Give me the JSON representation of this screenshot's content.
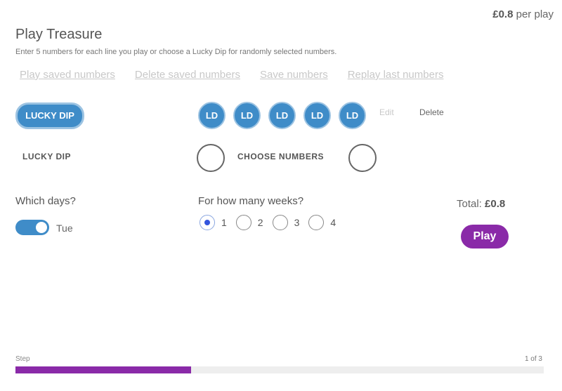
{
  "header": {
    "price_value": "£0.8",
    "price_suffix": "per play",
    "title": "Play Treasure",
    "subtitle": "Enter 5 numbers for each line you play or choose a Lucky Dip for randomly selected numbers."
  },
  "links": [
    {
      "label": "Play saved numbers"
    },
    {
      "label": "Delete saved numbers"
    },
    {
      "label": "Save numbers"
    },
    {
      "label": "Replay last numbers"
    }
  ],
  "line": {
    "lucky_dip_button": "LUCKY DIP",
    "balls": [
      "LD",
      "LD",
      "LD",
      "LD",
      "LD"
    ],
    "edit_label": "Edit",
    "delete_label": "Delete"
  },
  "options": {
    "lucky_dip_label": "LUCKY DIP",
    "choose_numbers_label": "CHOOSE NUMBERS"
  },
  "days": {
    "title": "Which days?",
    "toggle_label": "Tue",
    "toggle_on": true
  },
  "weeks": {
    "title": "For how many weeks?",
    "options": [
      "1",
      "2",
      "3",
      "4"
    ],
    "selected": "1"
  },
  "summary": {
    "total_label": "Total:",
    "total_value": "£0.8",
    "play_button": "Play"
  },
  "progress": {
    "step_label": "Step",
    "step_count": "1 of 3",
    "fraction": 0.333
  },
  "colors": {
    "accent_blue": "#3f8cc8",
    "accent_purple": "#8a2aa8"
  }
}
